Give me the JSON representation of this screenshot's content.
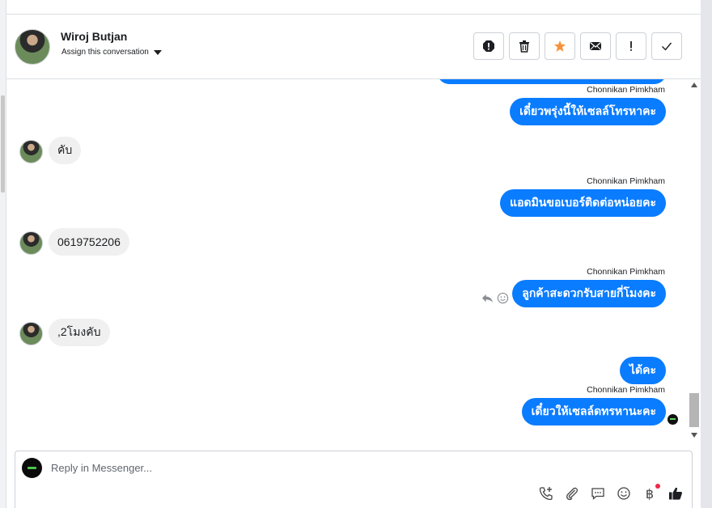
{
  "header": {
    "name": "Wiroj Butjan",
    "assign_label": "Assign this conversation"
  },
  "messages": [
    {
      "side": "out",
      "sender": "Chonnikan Pimkham",
      "text": "เดี๋ยวพรุ่งนี้ให้เซลล์โทรหาคะ"
    },
    {
      "side": "in",
      "text": "คับ"
    },
    {
      "side": "out",
      "sender": "Chonnikan Pimkham",
      "text": "แอดมินขอเบอร์ติดต่อหน่อยคะ"
    },
    {
      "side": "in",
      "text": "0619752206"
    },
    {
      "side": "out",
      "sender": "Chonnikan Pimkham",
      "text": "ลูกค้าสะดวกรับสายกี่โมงคะ"
    },
    {
      "side": "in",
      "text": ",2โมงคับ"
    },
    {
      "side": "out",
      "text": "ได้คะ"
    },
    {
      "side": "out",
      "sender": "Chonnikan Pimkham",
      "text": "เดี๋ยวให้เซลล์ดทรหานะคะ"
    }
  ],
  "composer": {
    "placeholder": "Reply in Messenger..."
  },
  "icons": {
    "toolbar": [
      "spam-icon",
      "trash-icon",
      "star-icon",
      "mail-icon",
      "important-icon",
      "check-icon"
    ],
    "composer": [
      "call-add-icon",
      "attachment-icon",
      "saved-replies-icon",
      "emoji-icon",
      "baht-payment-icon",
      "like-icon"
    ]
  },
  "colors": {
    "outgoing_bubble": "#0a7cff",
    "incoming_bubble": "#f0f0f0",
    "star": "#f7923b",
    "notification_dot": "#f02849"
  }
}
